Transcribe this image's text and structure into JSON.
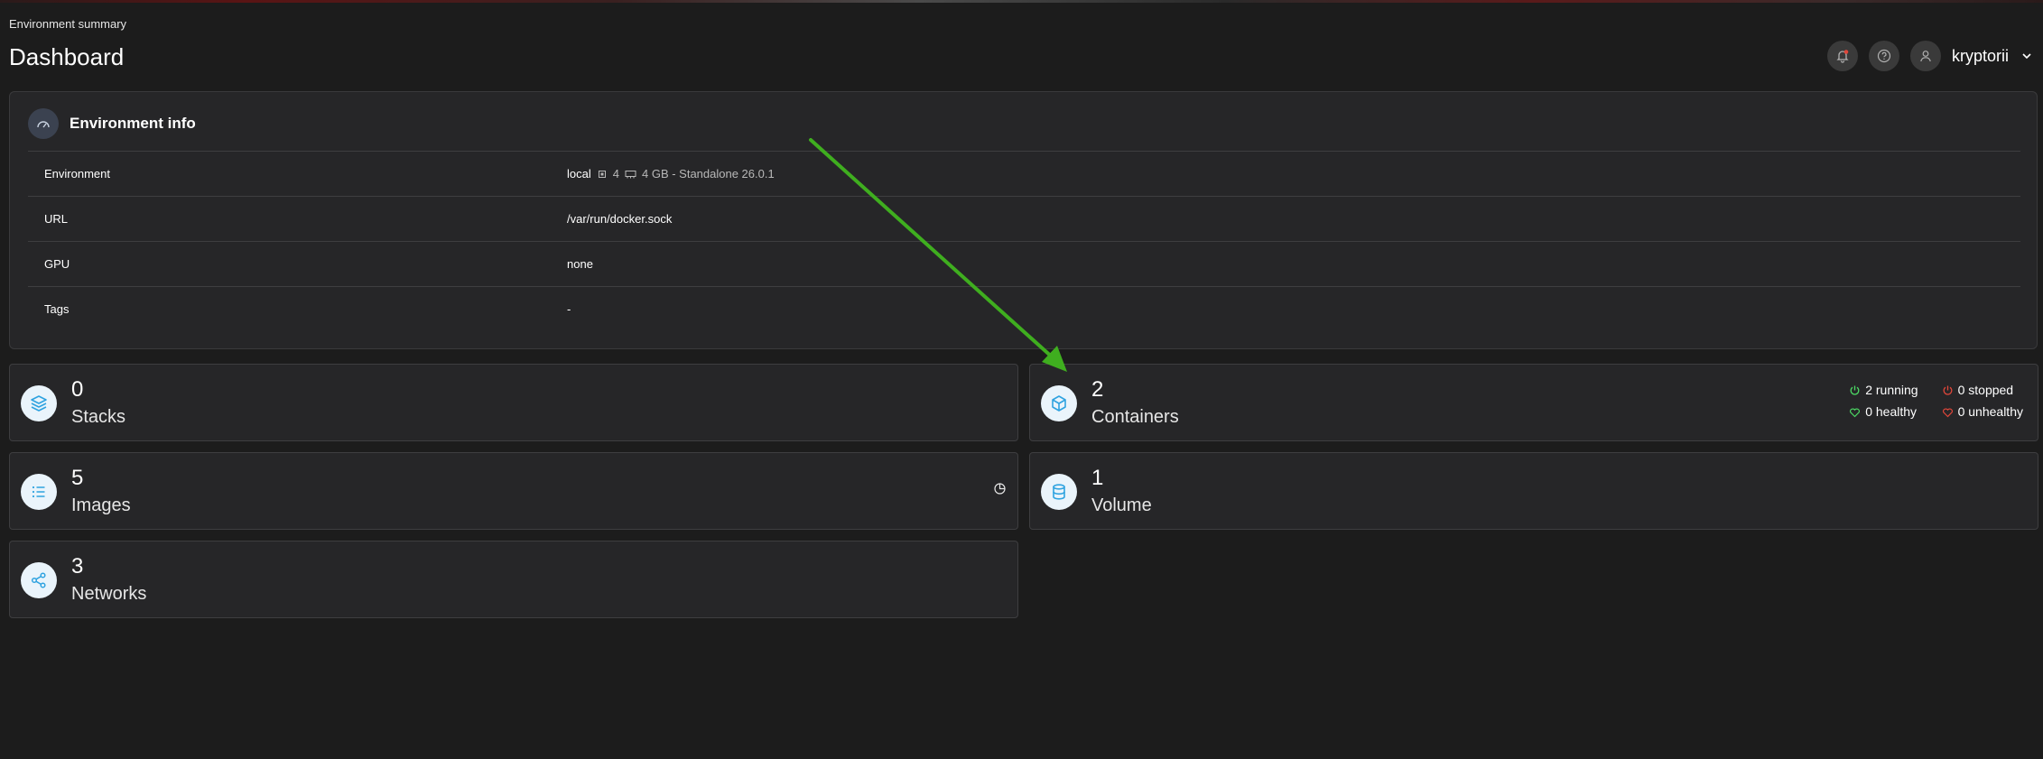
{
  "breadcrumb": "Environment summary",
  "page_title": "Dashboard",
  "user": {
    "name": "kryptorii"
  },
  "colors": {
    "accent": "#2fa3e0",
    "green": "#4cd964",
    "red": "#e0463a",
    "arrow": "#3fae1f"
  },
  "env": {
    "title": "Environment info",
    "rows": [
      {
        "key": "Environment",
        "value": "local",
        "cpu": "4",
        "mem": "4 GB - Standalone 26.0.1"
      },
      {
        "key": "URL",
        "value": "/var/run/docker.sock"
      },
      {
        "key": "GPU",
        "value": "none"
      },
      {
        "key": "Tags",
        "value": "-"
      }
    ]
  },
  "cards": {
    "stacks": {
      "count": "0",
      "label": "Stacks"
    },
    "containers": {
      "count": "2",
      "label": "Containers",
      "running": "2 running",
      "stopped": "0 stopped",
      "healthy": "0 healthy",
      "unhealthy": "0 unhealthy"
    },
    "images": {
      "count": "5",
      "label": "Images"
    },
    "volume": {
      "count": "1",
      "label": "Volume"
    },
    "networks": {
      "count": "3",
      "label": "Networks"
    }
  }
}
